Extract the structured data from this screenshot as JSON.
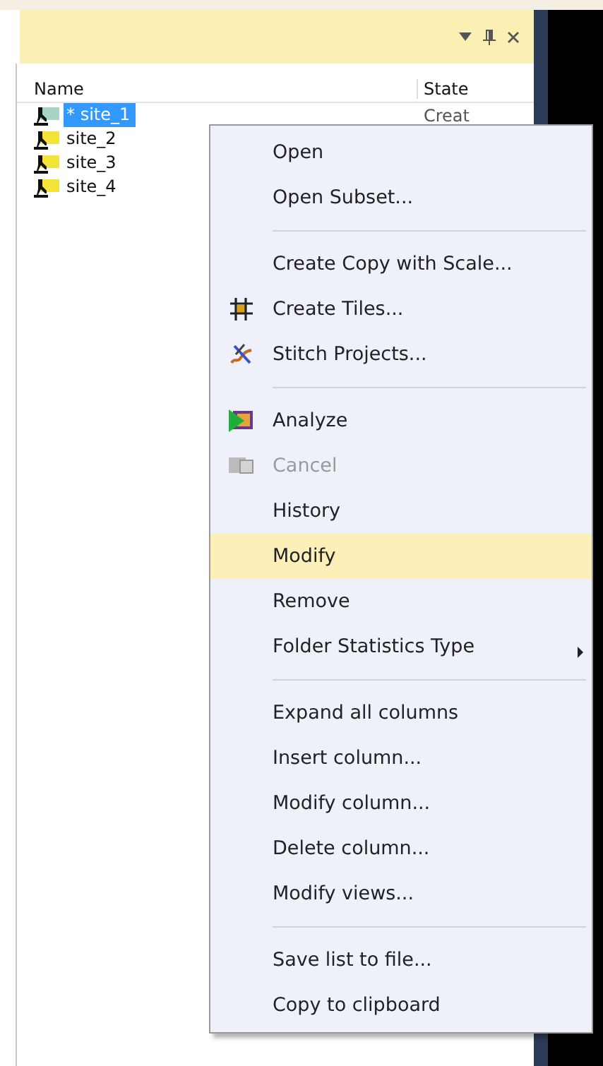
{
  "panel": {
    "columns": [
      "Name",
      "State"
    ],
    "rows": [
      {
        "name": "* site_1",
        "state": "Creat",
        "selected": true
      },
      {
        "name": "site_2",
        "selected": false
      },
      {
        "name": "site_3",
        "selected": false
      },
      {
        "name": "site_4",
        "selected": false
      }
    ]
  },
  "context_menu": {
    "items": [
      {
        "kind": "item",
        "label": "Open",
        "disabled": false,
        "selected": false,
        "submenu": false
      },
      {
        "kind": "item",
        "label": "Open Subset...",
        "disabled": false,
        "selected": false,
        "submenu": false
      },
      {
        "kind": "separator"
      },
      {
        "kind": "item",
        "label": "Create Copy with Scale...",
        "disabled": false,
        "selected": false,
        "submenu": false
      },
      {
        "kind": "item",
        "label": "Create Tiles...",
        "disabled": false,
        "selected": false,
        "submenu": false
      },
      {
        "kind": "item",
        "label": "Stitch Projects...",
        "disabled": false,
        "selected": false,
        "submenu": false
      },
      {
        "kind": "separator"
      },
      {
        "kind": "item",
        "label": "Analyze",
        "disabled": false,
        "selected": false,
        "submenu": false
      },
      {
        "kind": "item",
        "label": "Cancel",
        "disabled": true,
        "selected": false,
        "submenu": false
      },
      {
        "kind": "item",
        "label": "History",
        "disabled": false,
        "selected": false,
        "submenu": false
      },
      {
        "kind": "item",
        "label": "Modify",
        "disabled": false,
        "selected": true,
        "submenu": false
      },
      {
        "kind": "item",
        "label": "Remove",
        "disabled": false,
        "selected": false,
        "submenu": false
      },
      {
        "kind": "item",
        "label": "Folder Statistics Type",
        "disabled": false,
        "selected": false,
        "submenu": true
      },
      {
        "kind": "separator"
      },
      {
        "kind": "item",
        "label": "Expand all columns",
        "disabled": false,
        "selected": false,
        "submenu": false
      },
      {
        "kind": "item",
        "label": "Insert column...",
        "disabled": false,
        "selected": false,
        "submenu": false
      },
      {
        "kind": "item",
        "label": "Modify column...",
        "disabled": false,
        "selected": false,
        "submenu": false
      },
      {
        "kind": "item",
        "label": "Delete column...",
        "disabled": false,
        "selected": false,
        "submenu": false
      },
      {
        "kind": "item",
        "label": "Modify views...",
        "disabled": false,
        "selected": false,
        "submenu": false
      },
      {
        "kind": "separator"
      },
      {
        "kind": "item",
        "label": "Save list to file...",
        "disabled": false,
        "selected": false,
        "submenu": false
      },
      {
        "kind": "item",
        "label": "Copy to clipboard",
        "disabled": false,
        "selected": false,
        "submenu": false
      }
    ]
  }
}
